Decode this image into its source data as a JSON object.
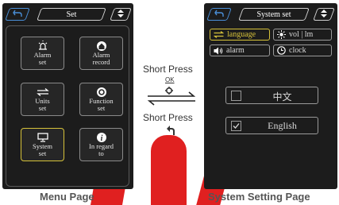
{
  "menu_page": {
    "title": "Set",
    "items": [
      {
        "label": "Alarm\nset",
        "icon": "alarm-icon"
      },
      {
        "label": "Alarm\nrecord",
        "icon": "record-icon"
      },
      {
        "label": "Units\nset",
        "icon": "swap-arrows-icon"
      },
      {
        "label": "Function\nset",
        "icon": "gear-icon"
      },
      {
        "label": "System\nset",
        "icon": "monitor-icon",
        "selected": true
      },
      {
        "label": "In regard\nto",
        "icon": "info-icon"
      }
    ]
  },
  "system_page": {
    "title": "System set",
    "chips": [
      {
        "label": "language",
        "icon": "swap-arrows-icon",
        "selected": true
      },
      {
        "label": "vol | lm",
        "icon": "brightness-icon"
      },
      {
        "label": "alarm",
        "icon": "speaker-icon"
      },
      {
        "label": "clock",
        "icon": "clock-icon"
      }
    ],
    "languages": [
      {
        "label": "中文",
        "checked": false
      },
      {
        "label": "English",
        "checked": true
      }
    ]
  },
  "transition": {
    "top_label": "Short Press",
    "top_key": "OK",
    "bottom_label": "Short Press"
  },
  "captions": {
    "left": "Menu Page",
    "right": "System Setting Page"
  },
  "colors": {
    "screen_bg": "#1c1c1c",
    "accent_blue": "#4a8fd8",
    "selected_yellow": "#d6c23a",
    "watermark_red": "#e02020"
  }
}
